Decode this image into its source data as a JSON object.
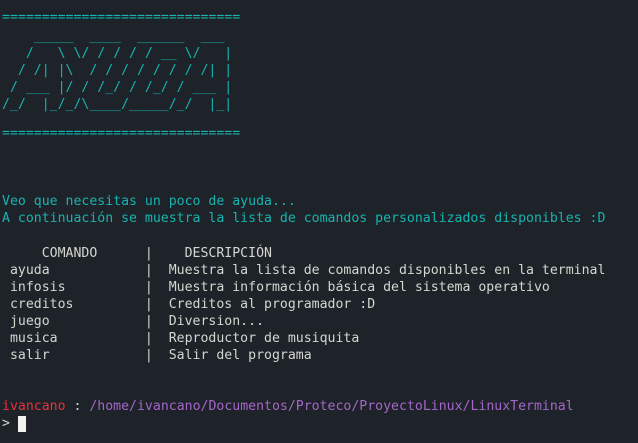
{
  "banner": {
    "separator_top": "==============================",
    "art": [
      "    _____  ____  ______  ___",
      "   /   \\ \\/ / / / / __ \\/   |",
      "  / /| |\\  / / / / / / / /| |",
      " / ___ |/ / /_/ / /_/ / ___ |",
      "/_/  |_/_/\\____/_____/_/  |_|"
    ],
    "separator_bottom": "=============================="
  },
  "messages": {
    "help_intro": "Veo que necesitas un poco de ayuda...",
    "list_intro": "A continuación se muestra la lista de comandos personalizados disponibles :D"
  },
  "table": {
    "header": "     COMANDO      |    DESCRIPCIÓN",
    "rows": [
      " ayuda            |  Muestra la lista de comandos disponibles en la terminal",
      " infosis          |  Muestra información básica del sistema operativo",
      " creditos         |  Creditos al programador :D",
      " juego            |  Diversion...",
      " musica           |  Reproductor de musiquita",
      " salir            |  Salir del programa"
    ]
  },
  "prompt": {
    "user": "ivancano",
    "separator": " : ",
    "path": "/home/ivancano/Documentos/Proteco/ProyectoLinux/LinuxTerminal",
    "symbol": ">"
  },
  "colors": {
    "background": "#1e2229",
    "banner": "#16b4b0",
    "text": "#d3d7cf",
    "user": "#e5323d",
    "path": "#a466c8",
    "cursor": "#f2f2f2"
  }
}
